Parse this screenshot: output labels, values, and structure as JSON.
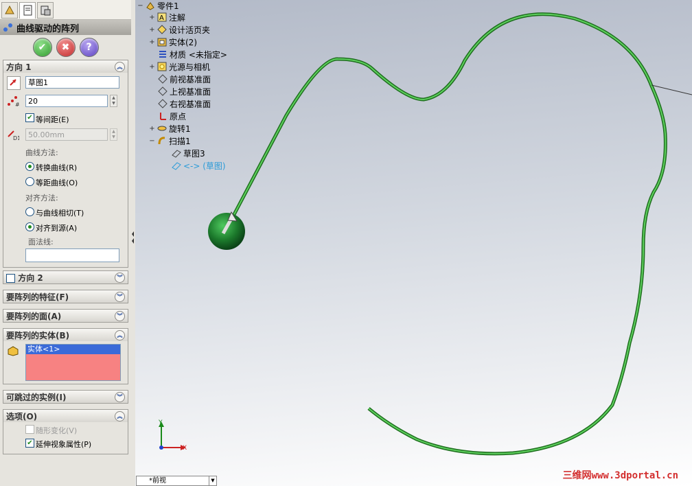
{
  "panel": {
    "title": "曲线驱动的阵列",
    "buttons": {
      "ok": "✔",
      "cancel": "✖",
      "help": "?"
    },
    "direction1": {
      "header": "方向 1",
      "sketch_value": "草图1",
      "count_value": "20",
      "equal_spacing_label": "等间距(E)",
      "equal_spacing_checked": true,
      "spacing_value": "50.00mm",
      "curve_method_label": "曲线方法:",
      "transform_curve_label": "转换曲线(R)",
      "offset_curve_label": "等距曲线(O)",
      "align_method_label": "对齐方法:",
      "tangent_label": "与曲线相切(T)",
      "align_source_label": "对齐到源(A)",
      "face_normal_label": "面法线:"
    },
    "direction2": {
      "header": "方向 2"
    },
    "features_header": "要阵列的特征(F)",
    "faces_header": "要阵列的面(A)",
    "bodies": {
      "header": "要阵列的实体(B)",
      "selected": "实体<1>"
    },
    "skip_header": "可跳过的实例(I)",
    "options": {
      "header": "选项(O)",
      "geometry_label": "随形变化(V)",
      "propagate_label": "延伸视象属性(P)"
    }
  },
  "tree": {
    "root": "零件1",
    "items": [
      "注解",
      "设计活页夹",
      "实体(2)",
      "材质 <未指定>",
      "光源与相机",
      "前视基准面",
      "上视基准面",
      "右视基准面",
      "原点",
      "旋转1",
      "扫描1",
      "草图3",
      "<-> (草图)"
    ]
  },
  "viewport": {
    "view_name": "*前视",
    "axis_x": "X",
    "axis_y": "Y",
    "watermark": "三维网www.3dportal.cn",
    "curve_color": "#2e9b2e",
    "sphere_color": "#1c7a2c"
  }
}
